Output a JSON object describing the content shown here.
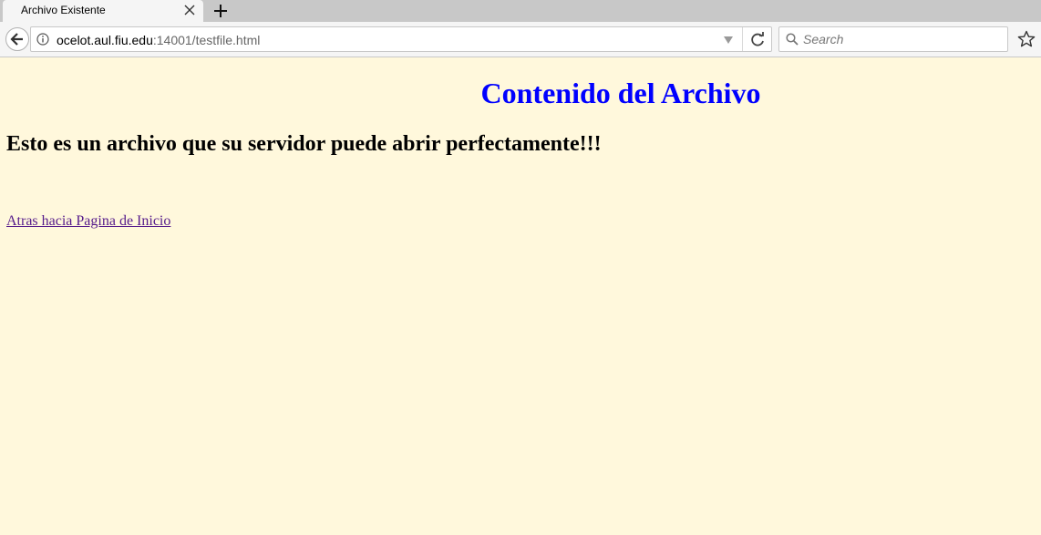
{
  "browser": {
    "tab": {
      "title": "Archivo Existente"
    },
    "url": {
      "host": "ocelot.aul.fiu.edu",
      "rest": ":14001/testfile.html"
    },
    "search": {
      "placeholder": "Search"
    }
  },
  "page": {
    "title": "Contenido del Archivo",
    "heading": "Esto es un archivo que su servidor puede abrir perfectamente!!!",
    "home_link": "Atras hacia Pagina de Inicio"
  },
  "colors": {
    "background": "#fff8dc",
    "title": "#0000ff",
    "visited_link": "#551a8b"
  },
  "icons": {
    "tab_close": "close-icon",
    "new_tab": "plus-icon",
    "back": "back-arrow-icon",
    "info": "info-icon",
    "dropdown": "dropdown-arrow-icon",
    "reload": "reload-icon",
    "search": "search-icon",
    "bookmark": "star-icon"
  }
}
